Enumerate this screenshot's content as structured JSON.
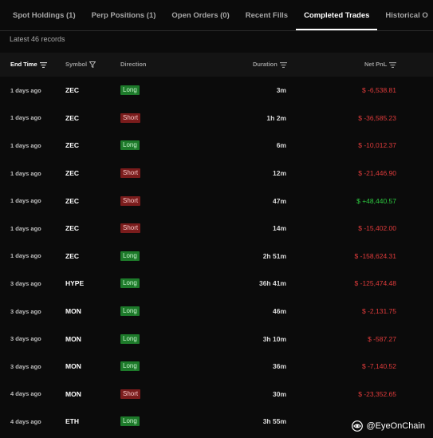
{
  "tabs": [
    {
      "label": "Spot Holdings (1)"
    },
    {
      "label": "Perp Positions (1)"
    },
    {
      "label": "Open Orders (0)"
    },
    {
      "label": "Recent Fills"
    },
    {
      "label": "Completed Trades"
    },
    {
      "label": "Historical O"
    }
  ],
  "active_tab": "Completed Trades",
  "records_text": "Latest 46 records",
  "columns": {
    "end_time": "End Time",
    "symbol": "Symbol",
    "direction": "Direction",
    "duration": "Duration",
    "net_pnl": "Net PnL"
  },
  "rows": [
    {
      "time": "1 days ago",
      "symbol": "ZEC",
      "direction": "Long",
      "duration": "3m",
      "pnl": "$ -6,538.81"
    },
    {
      "time": "1 days ago",
      "symbol": "ZEC",
      "direction": "Short",
      "duration": "1h 2m",
      "pnl": "$ -36,585.23"
    },
    {
      "time": "1 days ago",
      "symbol": "ZEC",
      "direction": "Long",
      "duration": "6m",
      "pnl": "$ -10,012.37"
    },
    {
      "time": "1 days ago",
      "symbol": "ZEC",
      "direction": "Short",
      "duration": "12m",
      "pnl": "$ -21,446.90"
    },
    {
      "time": "1 days ago",
      "symbol": "ZEC",
      "direction": "Short",
      "duration": "47m",
      "pnl": "$ +48,440.57"
    },
    {
      "time": "1 days ago",
      "symbol": "ZEC",
      "direction": "Short",
      "duration": "14m",
      "pnl": "$ -15,402.00"
    },
    {
      "time": "1 days ago",
      "symbol": "ZEC",
      "direction": "Long",
      "duration": "2h 51m",
      "pnl": "$ -158,624.31"
    },
    {
      "time": "3 days ago",
      "symbol": "HYPE",
      "direction": "Long",
      "duration": "36h 41m",
      "pnl": "$ -125,474.48"
    },
    {
      "time": "3 days ago",
      "symbol": "MON",
      "direction": "Long",
      "duration": "46m",
      "pnl": "$ -2,131.75"
    },
    {
      "time": "3 days ago",
      "symbol": "MON",
      "direction": "Long",
      "duration": "3h 10m",
      "pnl": "$ -587.27"
    },
    {
      "time": "3 days ago",
      "symbol": "MON",
      "direction": "Long",
      "duration": "36m",
      "pnl": "$ -7,140.52"
    },
    {
      "time": "4 days ago",
      "symbol": "MON",
      "direction": "Short",
      "duration": "30m",
      "pnl": "$ -23,352.65"
    },
    {
      "time": "4 days ago",
      "symbol": "ETH",
      "direction": "Long",
      "duration": "3h 55m",
      "pnl": ""
    }
  ],
  "watermark": {
    "text": "@EyeOnChain",
    "icon": "eye-logo-icon"
  },
  "colors": {
    "background": "#0b0b0b",
    "loss": "#e03b3b",
    "profit": "#2ecc40",
    "long_badge": "#1d7a2a",
    "short_badge": "#7a1c1c"
  }
}
